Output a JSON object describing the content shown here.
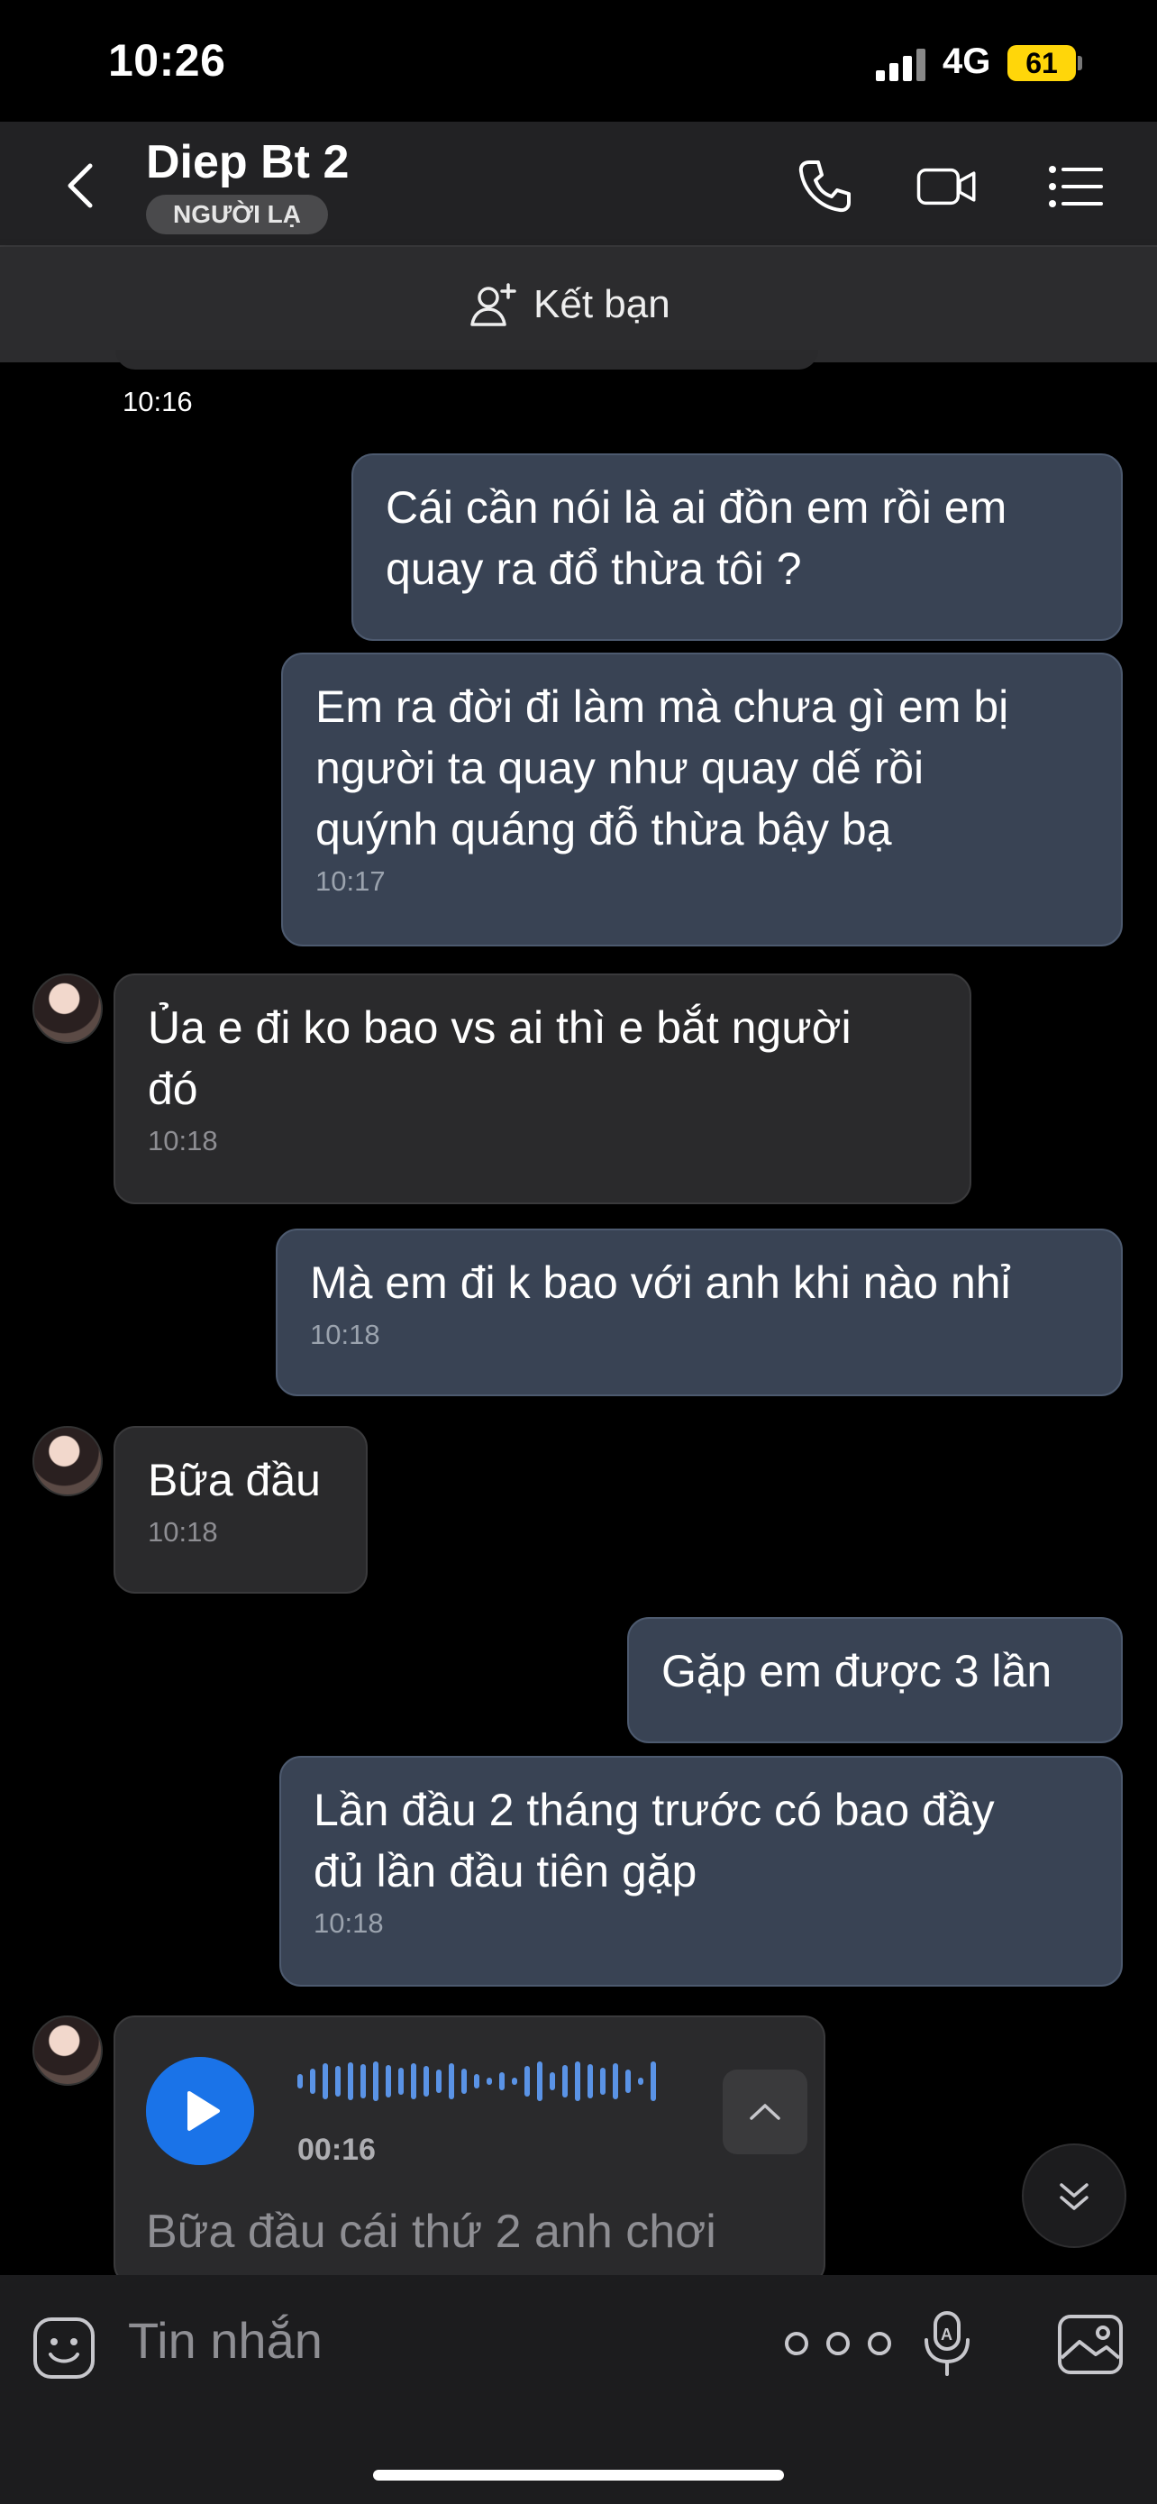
{
  "status_bar": {
    "time": "10:26",
    "network": "4G",
    "battery": "61"
  },
  "header": {
    "contact_name": "Diep Bt 2",
    "badge": "NGƯỜI LẠ"
  },
  "friend_bar": {
    "label": "Kết bạn"
  },
  "timestamp_top": "10:16",
  "messages": [
    {
      "dir": "out",
      "text": "Cái cần nói là ai đồn em rồi em\nquay ra đổ thừa tôi ?",
      "time": ""
    },
    {
      "dir": "out",
      "text": "Em ra đời đi làm mà chưa gì em bị\nngười ta quay như quay dế rồi\nquýnh quáng đỗ thừa bậy bạ",
      "time": "10:17"
    },
    {
      "dir": "in",
      "text": "Ủa e đi ko bao vs ai thì e bắt người\nđó",
      "time": "10:18"
    },
    {
      "dir": "out",
      "text": "Mà em đi k bao với anh khi nào nhỉ",
      "time": "10:18"
    },
    {
      "dir": "in",
      "text": "Bữa đầu",
      "time": "10:18"
    },
    {
      "dir": "out",
      "text": "Gặp em được 3 lần",
      "time": ""
    },
    {
      "dir": "out",
      "text": "Lần đầu 2 tháng trước có bao đầy\nđủ lần đầu tiên gặp",
      "time": "10:18"
    }
  ],
  "voice_message": {
    "duration": "00:16",
    "transcript": "Bữa đầu cái thứ 2 anh chơi"
  },
  "input_bar": {
    "placeholder": "Tin nhắn"
  },
  "colors": {
    "outgoing_bubble": "#394354",
    "incoming_bubble": "#2a2a2c",
    "play_button": "#1a73e8",
    "battery": "#ffd60a"
  }
}
